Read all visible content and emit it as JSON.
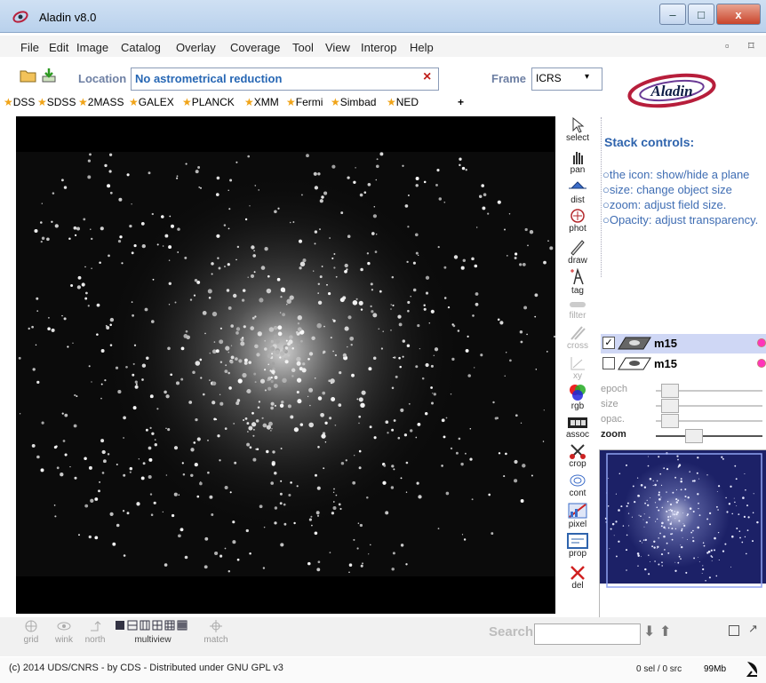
{
  "window": {
    "title": "Aladin v8.0",
    "min": "–",
    "max": "□",
    "close": "x"
  },
  "menu": [
    "File",
    "Edit",
    "Image",
    "Catalog",
    "Overlay",
    "Coverage",
    "Tool",
    "View",
    "Interop",
    "Help"
  ],
  "location": {
    "label": "Location",
    "value": "No astrometrical reduction",
    "clear": "×"
  },
  "frame": {
    "label": "Frame",
    "value": "ICRS",
    "arrow": "▾"
  },
  "logo": "Aladin",
  "surveys": [
    "DSS",
    "SDSS",
    "2MASS",
    "GALEX",
    "PLANCK",
    "XMM",
    "Fermi",
    "Simbad",
    "NED"
  ],
  "survey_add": "+",
  "tools": [
    "select",
    "pan",
    "dist",
    "phot",
    "draw",
    "tag",
    "filter",
    "cross",
    "xy",
    "rgb",
    "assoc",
    "crop",
    "cont",
    "pixel",
    "prop",
    "del"
  ],
  "stack": {
    "title": "Stack controls:",
    "help": [
      "○the icon: show/hide a plane",
      "○size: change object size",
      "○zoom: adjust field size.",
      "○Opacity: adjust transparency."
    ]
  },
  "planes": [
    {
      "name": "m15",
      "checked": true
    },
    {
      "name": "m15",
      "checked": false
    }
  ],
  "sliders": [
    {
      "label": "epoch",
      "enabled": false,
      "level": 0.05
    },
    {
      "label": "size",
      "enabled": false,
      "level": 0.05
    },
    {
      "label": "opac.",
      "enabled": false,
      "level": 0.05
    },
    {
      "label": "zoom",
      "enabled": true,
      "level": 0.3
    }
  ],
  "bottom": {
    "grid": "grid",
    "wink": "wink",
    "north": "north",
    "multiview": "multiview",
    "match": "match",
    "search": "Search"
  },
  "status": {
    "copyright": "(c) 2014 UDS/CNRS - by CDS - Distributed under GNU GPL v3",
    "selection": "0 sel / 0 src",
    "memory": "99Mb"
  },
  "colors": {
    "accent": "#2f64ad",
    "star": "#f0a418",
    "close": "#c9452c"
  }
}
